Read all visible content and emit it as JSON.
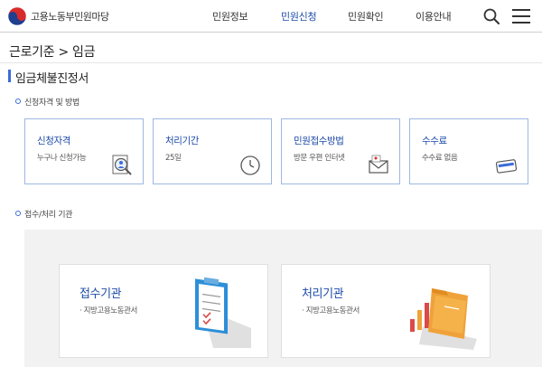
{
  "header": {
    "logo_text": "고용노동부민원마당",
    "nav": [
      {
        "label": "민원정보",
        "active": false
      },
      {
        "label": "민원신청",
        "active": true
      },
      {
        "label": "민원확인",
        "active": false
      },
      {
        "label": "이용안내",
        "active": false
      }
    ],
    "search_icon": "search-icon",
    "menu_icon": "hamburger-menu-icon"
  },
  "breadcrumb": "근로기준 > 임금",
  "page_title": "임금체불진정서",
  "sections": {
    "eligibility": "신청자격 및 방법",
    "agency": "접수/처리 기관"
  },
  "cards": [
    {
      "title": "신청자격",
      "desc": "누구나 신청가능",
      "icon": "person-magnifier-icon"
    },
    {
      "title": "처리기간",
      "desc": "25일",
      "icon": "clock-icon"
    },
    {
      "title": "민원접수방법",
      "desc": "방문 우편 인터넷",
      "icon": "mail-icon"
    },
    {
      "title": "수수료",
      "desc": "수수료 없음",
      "icon": "card-icon"
    }
  ],
  "agencies": [
    {
      "title": "접수기관",
      "desc": "· 지방고용노동관서",
      "icon": "clipboard-icon"
    },
    {
      "title": "처리기관",
      "desc": "· 지방고용노동관서",
      "icon": "folder-chart-icon"
    }
  ],
  "colors": {
    "accent": "#1d4ba8",
    "card_border": "#9eb7e3",
    "bullet": "#3b6dd8",
    "agency_bg": "#f2f2f2"
  }
}
